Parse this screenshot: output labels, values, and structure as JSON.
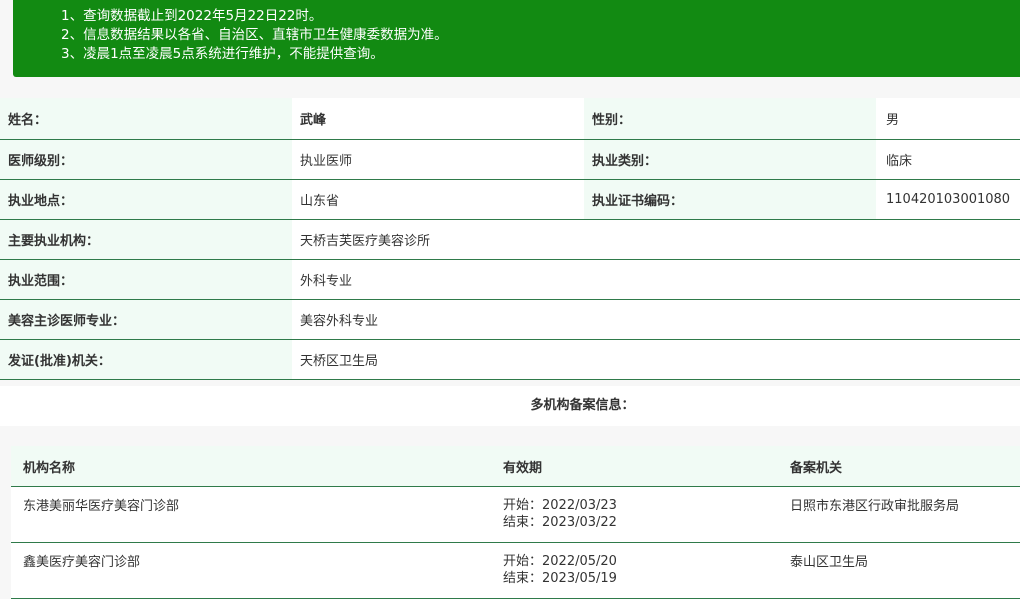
{
  "notice": {
    "lines": [
      "1、查询数据截止到2022年5月22日22时。",
      "2、信息数据结果以各省、自治区、直辖市卫生健康委数据为准。",
      "3、凌晨1点至凌晨5点系统进行维护，不能提供查询。"
    ]
  },
  "doctor": {
    "name_label": "姓名：",
    "name": "武峰",
    "gender_label": "性别：",
    "gender": "男",
    "level_label": "医师级别：",
    "level": "执业医师",
    "type_label": "执业类别：",
    "type": "临床",
    "location_label": "执业地点：",
    "location": "山东省",
    "cert_label": "执业证书编码：",
    "cert": "110420103001080",
    "org_label": "主要执业机构：",
    "org": "天桥吉芙医疗美容诊所",
    "scope_label": "执业范围：",
    "scope": "外科专业",
    "specialty_label": "美容主诊医师专业：",
    "specialty": "美容外科专业",
    "issuer_label": "发证(批准)机关：",
    "issuer": "天桥区卫生局"
  },
  "multi": {
    "title": "多机构备案信息：",
    "headers": [
      "机构名称",
      "有效期",
      "备案机关"
    ],
    "rows": [
      {
        "org": "东港美丽华医疗美容门诊部",
        "start": "开始：2022/03/23",
        "end": "结束：2023/03/22",
        "authority": "日照市东港区行政审批服务局"
      },
      {
        "org": "鑫美医疗美容门诊部",
        "start": "开始：2022/05/20",
        "end": "结束：2023/05/19",
        "authority": "泰山区卫生局"
      }
    ]
  },
  "colors": {
    "notice_bg": "#128a12",
    "label_bg": "#f1fbf5",
    "border": "#2f7a4a"
  }
}
